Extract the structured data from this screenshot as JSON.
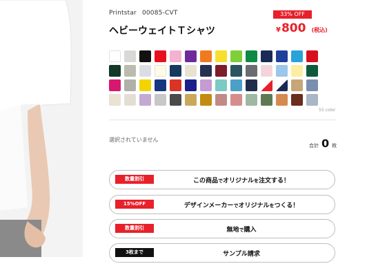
{
  "product": {
    "brand": "Printstar",
    "code": "00085-CVT",
    "title": "ヘビーウェイトＴシャツ",
    "discount_badge": "33% OFF",
    "price_symbol": "¥",
    "price": "800",
    "tax_note": "(税込)"
  },
  "colors": [
    "#ffffff",
    "#d8d8d6",
    "#111111",
    "#e8101e",
    "#f3b3d0",
    "#6d2b9a",
    "#f07a20",
    "#f6df2e",
    "#7fcf3a",
    "#0f8a45",
    "#1b2a55",
    "#1f3f99",
    "#2aa3d9",
    "#d8101e",
    "#123826",
    "#bcbbb0",
    "#dadde2",
    "#fffbe6",
    "#143a5e",
    "#e8e2cf",
    "#253152",
    "#7e1c2a",
    "#2a5560",
    "#6a6c70",
    "#f6d3da",
    "#9cc6ea",
    "#fbeea0",
    "#0e5a3d",
    "#d8186e",
    "#b0b0a8",
    "#f3d400",
    "#15377e",
    "#d93427",
    "#1c1f8a",
    "#c59bd3",
    "#7bcac4",
    "#4aa0c7",
    "#1f2d4a",
    "#e8202a",
    "#1b2a55",
    "#c7a678",
    "#7a8fb0",
    "#ece2cf",
    "#e3ddd2",
    "#c3a9d1",
    "#c7c7c7",
    "#4a4a4a",
    "#c9a85a",
    "#c38b10",
    "#c28a86",
    "#d68e8a",
    "#9eb9a1",
    "#5f7a52",
    "#d58a52",
    "#6a2e1c",
    "#a9b6c6"
  ],
  "color_count": "55 color",
  "selection": {
    "status": "選択されていません",
    "total_label": "合計",
    "total_value": "0",
    "total_unit": "枚"
  },
  "actions": [
    {
      "tag": "数量割引",
      "tag_style": "red",
      "label_a": "この商品",
      "label_b": "で",
      "label_c": "オリジナル",
      "label_d": "を",
      "label_e": "注文する！"
    },
    {
      "tag": "15%OFF",
      "tag_style": "red",
      "label_a": "デザインメーカー",
      "label_b": "で",
      "label_c": "オリジナル",
      "label_d": "を",
      "label_e": "つくる！"
    },
    {
      "tag": "数量割引",
      "tag_style": "red",
      "label_a": "無地",
      "label_b": "で",
      "label_c": "購入",
      "label_d": "",
      "label_e": ""
    },
    {
      "tag": "3枚まで",
      "tag_style": "black",
      "label_a": "サンプル請求",
      "label_b": "",
      "label_c": "",
      "label_d": "",
      "label_e": ""
    }
  ]
}
